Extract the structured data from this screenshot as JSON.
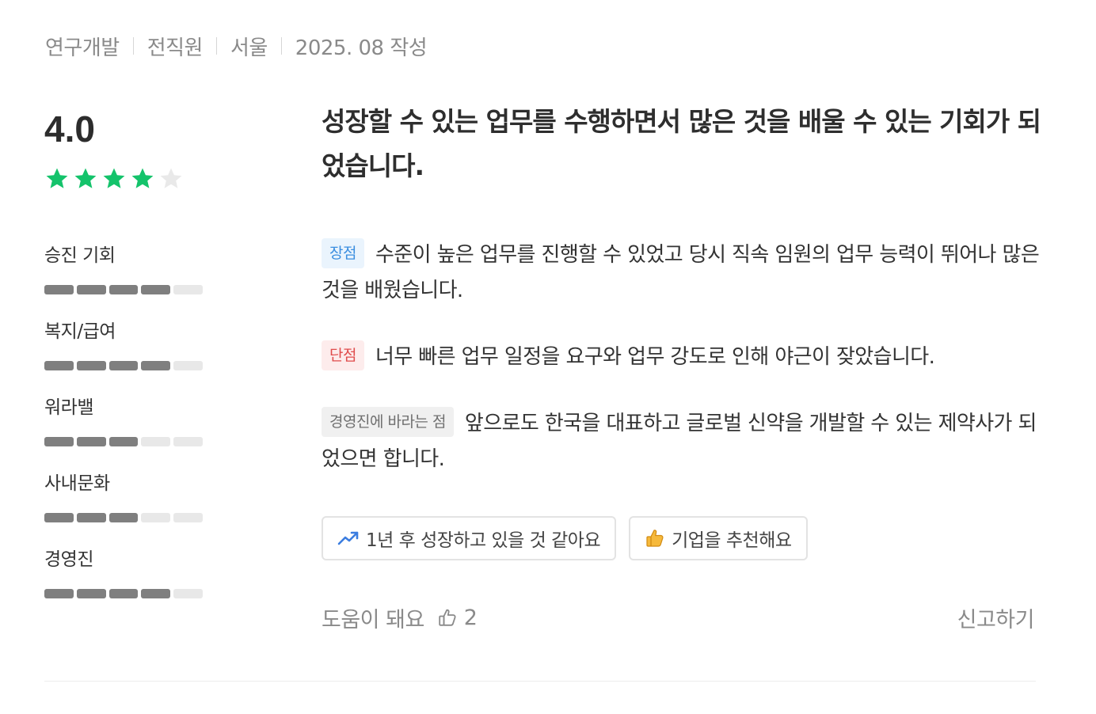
{
  "meta": {
    "job": "연구개발",
    "status": "전직원",
    "location": "서울",
    "date": "2025. 08 작성"
  },
  "rating": {
    "score": "4.0",
    "stars_filled": 4,
    "stars_total": 5,
    "star_color": "#14c36b",
    "star_empty_color": "#e9e9e9"
  },
  "categories": [
    {
      "label": "승진 기회",
      "filled": 4,
      "total": 5
    },
    {
      "label": "복지/급여",
      "filled": 4,
      "total": 5
    },
    {
      "label": "워라밸",
      "filled": 3,
      "total": 5
    },
    {
      "label": "사내문화",
      "filled": 3,
      "total": 5
    },
    {
      "label": "경영진",
      "filled": 4,
      "total": 5
    }
  ],
  "review": {
    "headline": "성장할 수 있는 업무를 수행하면서 많은 것을 배울 수 있는 기회가 되었습니다.",
    "pros_tag": "장점",
    "pros": "수준이 높은 업무를 진행할 수 있었고 당시 직속 임원의 업무 능력이 뛰어나 많은 것을 배웠습니다.",
    "cons_tag": "단점",
    "cons": "너무 빠른 업무 일정을 요구와 업무 강도로 인해 야근이 잦았습니다.",
    "wish_tag": "경영진에 바라는 점",
    "wish": "앞으로도 한국을 대표하고 글로벌 신약을 개발할 수 있는 제약사가 되었으면 합니다."
  },
  "chips": {
    "growth": "1년 후 성장하고 있을 것 같아요",
    "recommend": "기업을 추천해요"
  },
  "footer": {
    "helpful_label": "도움이 돼요",
    "helpful_count": "2",
    "report_label": "신고하기"
  },
  "colors": {
    "pros_accent": "#3b8ee0",
    "cons_accent": "#e04c4c",
    "growth_icon": "#3b7de0"
  }
}
